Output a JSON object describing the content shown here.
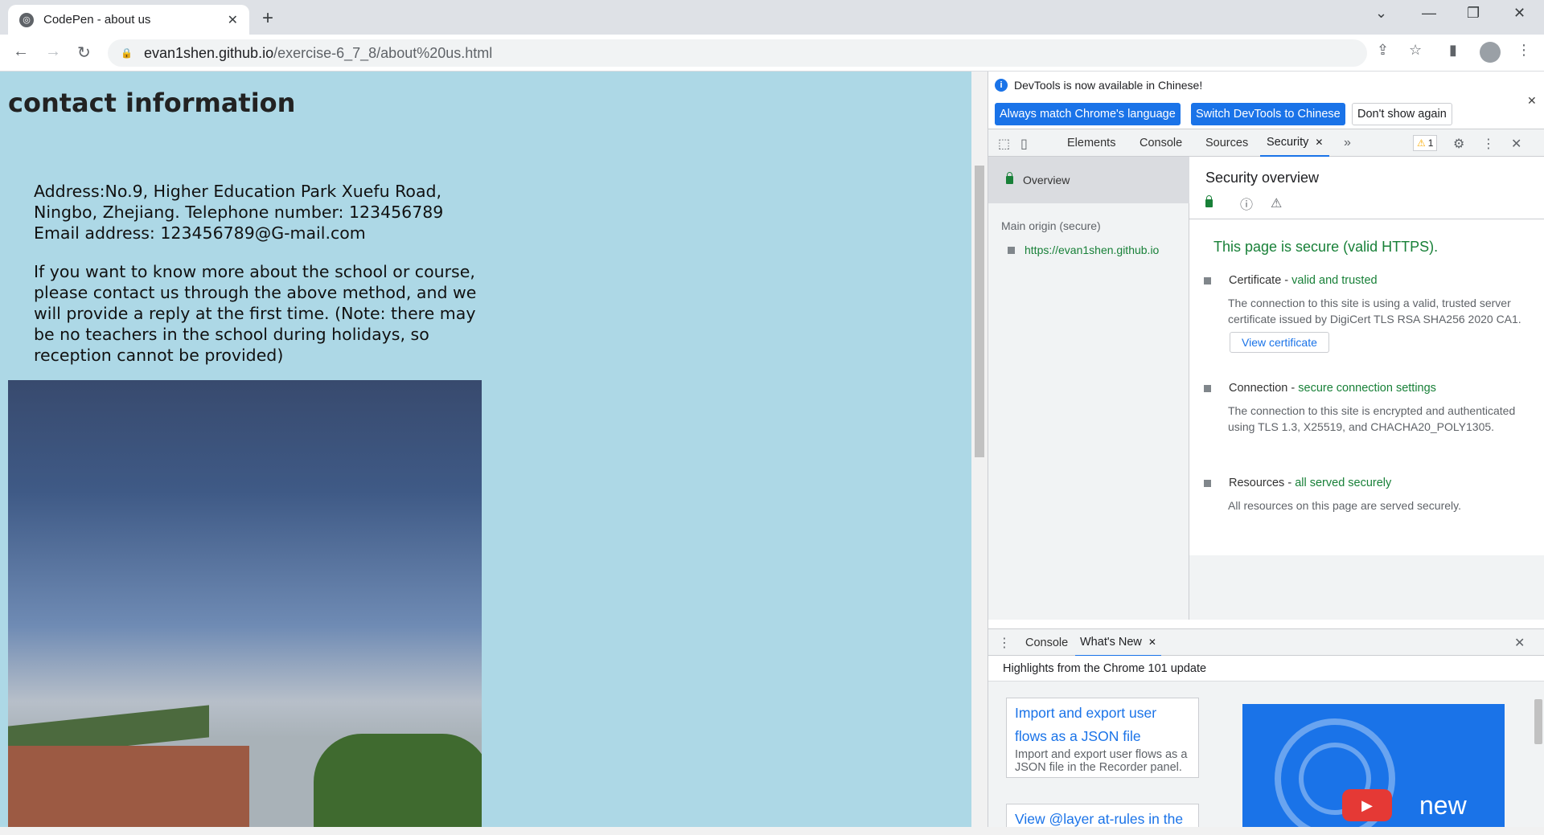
{
  "browser": {
    "tab_title": "CodePen - about us",
    "tab_close": "✕",
    "new_tab": "+",
    "url_host": "evan1shen.github.io",
    "url_path": "/exercise-6_7_8/about%20us.html"
  },
  "page": {
    "heading": "contact information",
    "address": "Address:No.9, Higher Education Park Xuefu Road, Ningbo, Zhejiang. Telephone number: 123456789 Email address: 123456789@G-mail.com",
    "contact_note": "If you want to know more about the school or course, please contact us through the above method, and we will provide a reply at the first time. (Note: there may be no teachers in the school during holidays, so reception cannot be provided)"
  },
  "devtools": {
    "infobar": {
      "message": "DevTools is now available in Chinese!",
      "btn_match": "Always match Chrome's language",
      "btn_switch": "Switch DevTools to Chinese",
      "btn_dismiss": "Don't show again"
    },
    "tabs": [
      "Elements",
      "Console",
      "Sources",
      "Security"
    ],
    "warning_count": "1",
    "security": {
      "sidebar_overview": "Overview",
      "main_origin_title": "Main origin (secure)",
      "origin_url": "https://evan1shen.github.io",
      "title": "Security overview",
      "secure_summary": "This page is secure (valid HTTPS).",
      "certificate": {
        "label": "Certificate",
        "status": "valid and trusted",
        "desc": "The connection to this site is using a valid, trusted server certificate issued by DigiCert TLS RSA SHA256 2020 CA1.",
        "button": "View certificate"
      },
      "connection": {
        "label": "Connection",
        "status": "secure connection settings",
        "desc": "The connection to this site is encrypted and authenticated using TLS 1.3, X25519, and CHACHA20_POLY1305."
      },
      "resources": {
        "label": "Resources",
        "status": "all served securely",
        "desc": "All resources on this page are served securely."
      }
    },
    "drawer": {
      "tab_console": "Console",
      "tab_whats_new": "What's New",
      "highlights": "Highlights from the Chrome 101 update",
      "card1_title": "Import and export user flows as a JSON file",
      "card1_desc": "Import and export user flows as a JSON file in the Recorder panel.",
      "card2_title": "View @layer at-rules in the",
      "banner_text": "new"
    }
  },
  "colors": {
    "page_bg": "#add8e6",
    "accent": "#1a73e8",
    "secure_green": "#188038"
  }
}
